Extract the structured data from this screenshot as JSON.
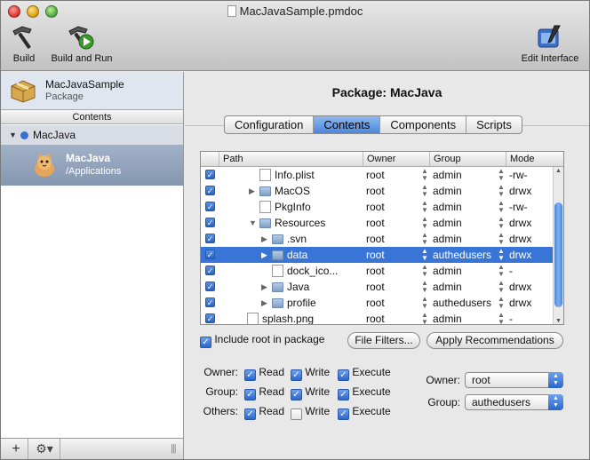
{
  "window": {
    "title": "MacJavaSample.pmdoc"
  },
  "toolbar": {
    "build_label": "Build",
    "build_run_label": "Build and Run",
    "edit_interface_label": "Edit Interface"
  },
  "sidebar": {
    "package_name": "MacJavaSample",
    "package_kind": "Package",
    "section_label": "Contents",
    "group_name": "MacJava",
    "selected_item": {
      "name": "MacJava",
      "path": "/Applications"
    },
    "add_label": "+",
    "gear_label": "⚙▾"
  },
  "main": {
    "title": "Package: MacJava",
    "tabs": [
      "Configuration",
      "Contents",
      "Components",
      "Scripts"
    ],
    "active_tab": "Contents"
  },
  "table": {
    "columns": [
      "Path",
      "Owner",
      "Group",
      "Mode"
    ],
    "rows": [
      {
        "name": "Info.plist",
        "type": "file",
        "indent": 3,
        "disclosure": "",
        "owner": "root",
        "group": "admin",
        "mode": "-rw-",
        "selected": false
      },
      {
        "name": "MacOS",
        "type": "folder",
        "indent": 3,
        "disclosure": "▶",
        "owner": "root",
        "group": "admin",
        "mode": "drwx",
        "selected": false
      },
      {
        "name": "PkgInfo",
        "type": "file",
        "indent": 3,
        "disclosure": "",
        "owner": "root",
        "group": "admin",
        "mode": "-rw-",
        "selected": false
      },
      {
        "name": "Resources",
        "type": "folder",
        "indent": 3,
        "disclosure": "▼",
        "owner": "root",
        "group": "admin",
        "mode": "drwx",
        "selected": false
      },
      {
        "name": ".svn",
        "type": "folder",
        "indent": 4,
        "disclosure": "▶",
        "owner": "root",
        "group": "admin",
        "mode": "drwx",
        "selected": false
      },
      {
        "name": "data",
        "type": "folder",
        "indent": 4,
        "disclosure": "▶",
        "owner": "root",
        "group": "authedusers",
        "mode": "drwx",
        "selected": true
      },
      {
        "name": "dock_ico...",
        "type": "file",
        "indent": 4,
        "disclosure": "",
        "owner": "root",
        "group": "admin",
        "mode": "-",
        "selected": false
      },
      {
        "name": "Java",
        "type": "folder",
        "indent": 4,
        "disclosure": "▶",
        "owner": "root",
        "group": "admin",
        "mode": "drwx",
        "selected": false
      },
      {
        "name": "profile",
        "type": "folder",
        "indent": 4,
        "disclosure": "▶",
        "owner": "root",
        "group": "authedusers",
        "mode": "drwx",
        "selected": false
      },
      {
        "name": "splash.png",
        "type": "file",
        "indent": 2,
        "disclosure": "",
        "owner": "root",
        "group": "admin",
        "mode": "-",
        "selected": false
      }
    ]
  },
  "options": {
    "include_root_label": "Include root in package",
    "include_root_checked": true,
    "file_filters_label": "File Filters...",
    "apply_recommendations_label": "Apply Recommendations"
  },
  "permissions": {
    "read_label": "Read",
    "write_label": "Write",
    "execute_label": "Execute",
    "rows": [
      {
        "label": "Owner:",
        "read": true,
        "write": true,
        "execute": true
      },
      {
        "label": "Group:",
        "read": true,
        "write": true,
        "execute": true
      },
      {
        "label": "Others:",
        "read": true,
        "write": false,
        "execute": true
      }
    ]
  },
  "ownership": {
    "owner_label": "Owner:",
    "owner_value": "root",
    "group_label": "Group:",
    "group_value": "authedusers"
  }
}
